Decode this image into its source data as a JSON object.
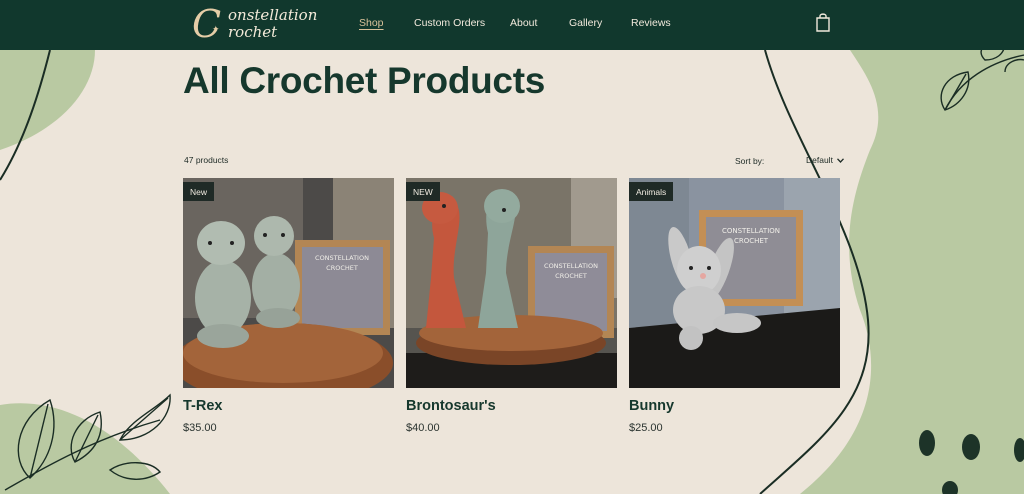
{
  "header": {
    "logo": {
      "line1": "onstellation",
      "line2": "rochet",
      "initial": "C",
      "star": "✦"
    },
    "nav": [
      {
        "label": "Shop",
        "active": true
      },
      {
        "label": "Custom Orders",
        "active": false
      },
      {
        "label": "About",
        "active": false
      },
      {
        "label": "Gallery",
        "active": false
      },
      {
        "label": "Reviews",
        "active": false
      }
    ],
    "cart_icon": "shopping-bag-icon"
  },
  "main": {
    "title": "All Crochet Products",
    "product_count": "47 products",
    "sort_label": "Sort by:",
    "sort_value": "Default"
  },
  "products": [
    {
      "name": "T-Rex",
      "price": "$35.00",
      "badge": "New",
      "sign_line1": "CONSTELLATION",
      "sign_line2": "CROCHET"
    },
    {
      "name": "Brontosaur's",
      "price": "$40.00",
      "badge": "NEW",
      "sign_line1": "CONSTELLATION",
      "sign_line2": "CROCHET"
    },
    {
      "name": "Bunny",
      "price": "$25.00",
      "badge": "Animals",
      "sign_line1": "CONSTELLATION",
      "sign_line2": "CROCHET"
    }
  ],
  "colors": {
    "header_bg": "#11382d",
    "page_bg": "#ede5da",
    "accent_green": "#b9c9a2",
    "title_green": "#16382d",
    "nav_active": "#d9c29a"
  }
}
